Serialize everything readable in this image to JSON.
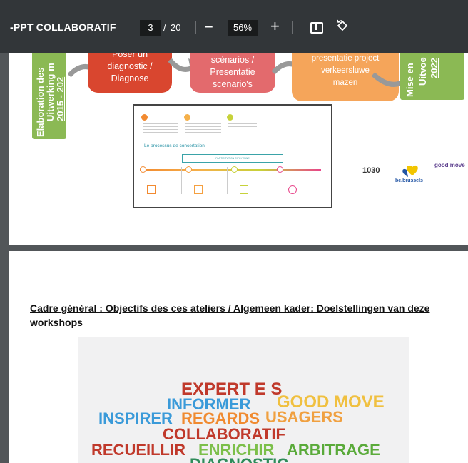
{
  "toolbar": {
    "title": "-PPT COLLABORATIF",
    "page_current": "3",
    "page_separator": "/",
    "page_total": "20",
    "zoom_out": "−",
    "zoom_level": "56%",
    "zoom_in": "+",
    "fit_icon": "fit-page-icon",
    "rotate_icon": "rotate-icon"
  },
  "page1": {
    "left_box": [
      "Elaboration des",
      "Uitwerking m",
      "2015 - 202"
    ],
    "step_diagnose": [
      "Poser un",
      "diagnostic /",
      "Diagnose"
    ],
    "step_scenarios": [
      "scénarios /",
      "Presentatie",
      "scenario's"
    ],
    "step_presentatie": [
      "presentatie project",
      "verkeersluwe",
      "mazen"
    ],
    "right_box": [
      "Mise en",
      "Uitvoe",
      "2022"
    ],
    "process_title": "Le processus de concertation",
    "process_bar": "PARTICIPATION CITOYENNE",
    "logos": {
      "schaerbeek": "1030",
      "be": "be.brussels",
      "good_move": "good move"
    }
  },
  "page2": {
    "heading": "Cadre général : Objectifs des ces ateliers / Algemeen kader: Doelstellingen van deze workshops",
    "words": [
      {
        "text": "EXPERT E S",
        "color": "#c0392b"
      },
      {
        "text": "INFORMER",
        "color": "#3a9ad9"
      },
      {
        "text": "GOOD MOVE",
        "color": "#f0c040"
      },
      {
        "text": "INSPIRER",
        "color": "#3a9ad9"
      },
      {
        "text": "REGARDS",
        "color": "#f08a30"
      },
      {
        "text": "USAGERS",
        "color": "#f0a040"
      },
      {
        "text": "COLLABORATIF",
        "color": "#c0392b"
      },
      {
        "text": "RECUEILLIR",
        "color": "#c0392b"
      },
      {
        "text": "ENRICHIR",
        "color": "#7cbf4a"
      },
      {
        "text": "ARBITRAGE",
        "color": "#5aaa3a"
      },
      {
        "text": "DIAGNOSTIC",
        "color": "#2f8c5a"
      }
    ]
  }
}
